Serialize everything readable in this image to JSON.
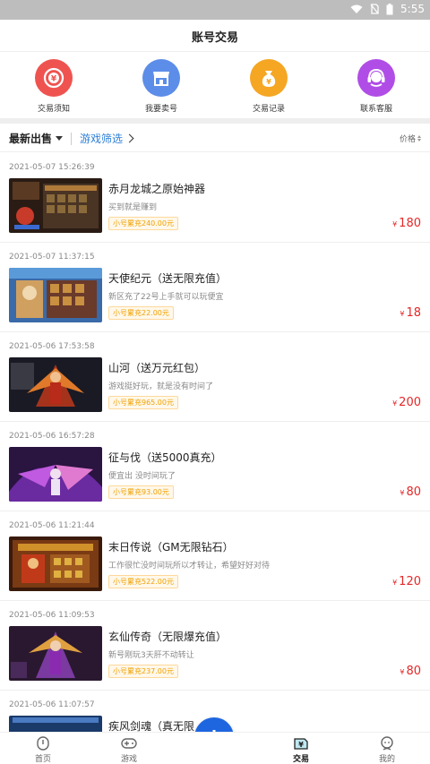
{
  "status_bar": {
    "time": "5:55"
  },
  "header": {
    "title": "账号交易"
  },
  "quick_actions": [
    {
      "label": "交易须知",
      "icon": "notice-icon",
      "color": "#ef5350"
    },
    {
      "label": "我要卖号",
      "icon": "shop-icon",
      "color": "#5c8de8"
    },
    {
      "label": "交易记录",
      "icon": "money-bag-icon",
      "color": "#f5a623"
    },
    {
      "label": "联系客服",
      "icon": "headset-icon",
      "color": "#b04de6"
    }
  ],
  "filter": {
    "sort_label": "最新出售",
    "game_filter": "游戏筛选",
    "price_label": "价格"
  },
  "listings": [
    {
      "time": "2021-05-07 15:26:39",
      "title": "赤月龙城之原始神器",
      "desc": "买到就是赚到",
      "badge": "小号累充240.00元",
      "price": "180"
    },
    {
      "time": "2021-05-07 11:37:15",
      "title": "天使纪元（送无限充值）",
      "desc": "新区充了22号上手就可以玩便宜",
      "badge": "小号累充22.00元",
      "price": "18"
    },
    {
      "time": "2021-05-06 17:53:58",
      "title": "山河（送万元红包）",
      "desc": "游戏挺好玩，就是没有时间了",
      "badge": "小号累充965.00元",
      "price": "200"
    },
    {
      "time": "2021-05-06 16:57:28",
      "title": "征与伐（送5000真充）",
      "desc": "便宜出 没时间玩了",
      "badge": "小号累充93.00元",
      "price": "80"
    },
    {
      "time": "2021-05-06 11:21:44",
      "title": "末日传说（GM无限钻石）",
      "desc": "工作很忙没时间玩所以才转让，希望好好对待",
      "badge": "小号累充522.00元",
      "price": "120"
    },
    {
      "time": "2021-05-06 11:09:53",
      "title": "玄仙传奇（无限爆充值）",
      "desc": "新号刚玩3天肝不动转让",
      "badge": "小号累充237.00元",
      "price": "80"
    },
    {
      "time": "2021-05-06 11:07:57",
      "title": "疾风剑魂（真无限",
      "desc": "",
      "badge": "",
      "price": ""
    }
  ],
  "currency_symbol": "¥",
  "tabs": [
    {
      "label": "首页",
      "icon": "home-icon"
    },
    {
      "label": "游戏",
      "icon": "gamepad-icon"
    },
    {
      "label": "交易",
      "icon": "trade-icon",
      "active": true
    },
    {
      "label": "我的",
      "icon": "profile-icon"
    }
  ],
  "fab": {
    "icon": "plus-icon",
    "color": "#1e66e0"
  }
}
